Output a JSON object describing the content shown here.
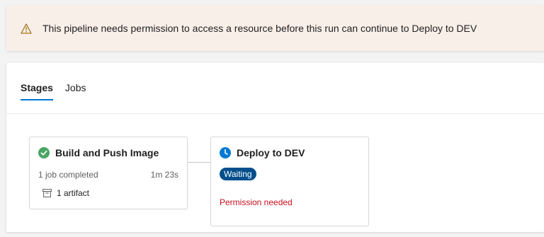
{
  "banner": {
    "message": "This pipeline needs permission to access a resource before this run can continue to Deploy to DEV",
    "icon": "warning-icon",
    "icon_color": "#a4731a"
  },
  "tabs": [
    {
      "label": "Stages",
      "active": true
    },
    {
      "label": "Jobs",
      "active": false
    }
  ],
  "stages": {
    "build": {
      "title": "Build and Push Image",
      "status_icon": "check-circle-icon",
      "status_color": "#4aa564",
      "jobs": "1 job completed",
      "duration": "1m 23s",
      "artifact": "1 artifact"
    },
    "deploy": {
      "title": "Deploy to DEV",
      "status_icon": "clock-icon",
      "status_color": "#0078d4",
      "badge": "Waiting",
      "badge_color": "#004e8c",
      "permission": "Permission needed",
      "permission_color": "#c50f1f"
    }
  }
}
